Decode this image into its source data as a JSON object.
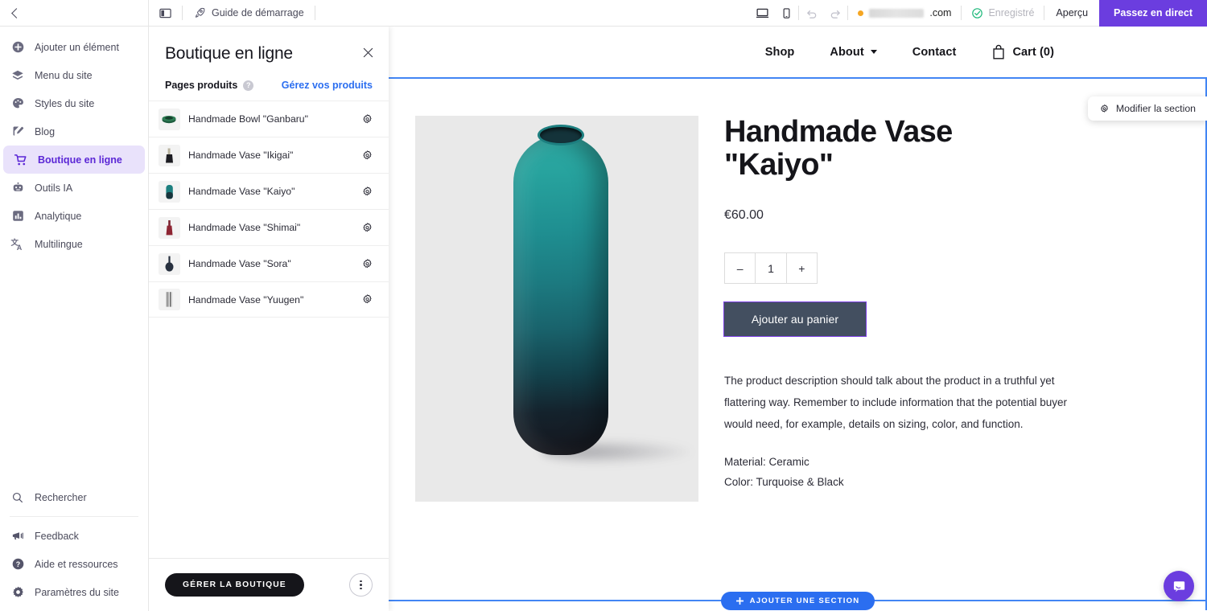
{
  "topbar": {
    "back_label": "back",
    "panel_toggle": "panel-toggle",
    "guide_label": "Guide de démarrage",
    "desktop_icon": "desktop-icon",
    "mobile_icon": "mobile-icon",
    "undo_icon": "undo-icon",
    "redo_icon": "redo-icon",
    "domain_suffix": ".com",
    "saved_label": "Enregistré",
    "preview_label": "Aperçu",
    "golive_label": "Passez en direct",
    "accent_purple": "#6b3ddf"
  },
  "sidebar": {
    "items": [
      {
        "label": "Ajouter un élément",
        "icon": "plus-circle-icon",
        "active": false
      },
      {
        "label": "Menu du site",
        "icon": "layers-icon",
        "active": false
      },
      {
        "label": "Styles du site",
        "icon": "palette-icon",
        "active": false
      },
      {
        "label": "Blog",
        "icon": "pencil-square-icon",
        "active": false
      },
      {
        "label": "Boutique en ligne",
        "icon": "shopping-cart-icon",
        "active": true
      },
      {
        "label": "Outils IA",
        "icon": "robot-icon",
        "active": false
      },
      {
        "label": "Analytique",
        "icon": "bar-chart-icon",
        "active": false
      },
      {
        "label": "Multilingue",
        "icon": "translate-icon",
        "active": false
      }
    ],
    "bottom_items": [
      {
        "label": "Rechercher",
        "icon": "search-icon"
      },
      {
        "label": "Feedback",
        "icon": "megaphone-icon"
      },
      {
        "label": "Aide et ressources",
        "icon": "question-circle-icon"
      },
      {
        "label": "Paramètres du site",
        "icon": "gear-icon"
      }
    ],
    "active_bg": "#e9e2fb",
    "active_fg": "#5b27d6"
  },
  "panel": {
    "title": "Boutique en ligne",
    "close_icon": "close-icon",
    "section_label": "Pages produits",
    "help_icon": "question-mark-icon",
    "manage_link": "Gérez vos produits",
    "products": [
      {
        "name": "Handmade Bowl \"Ganbaru\"",
        "thumb": "green-bowl",
        "gear": "gear-icon"
      },
      {
        "name": "Handmade Vase \"Ikigai\"",
        "thumb": "dark-bottle",
        "gear": "gear-icon"
      },
      {
        "name": "Handmade Vase \"Kaiyo\"",
        "thumb": "turquoise-vase",
        "gear": "gear-icon"
      },
      {
        "name": "Handmade Vase \"Shimai\"",
        "thumb": "red-bottle",
        "gear": "gear-icon"
      },
      {
        "name": "Handmade Vase \"Sora\"",
        "thumb": "navy-vase",
        "gear": "gear-icon"
      },
      {
        "name": "Handmade Vase \"Yuugen\"",
        "thumb": "grey-striped-vase",
        "gear": "gear-icon"
      }
    ],
    "manage_button": "GÉRER LA BOUTIQUE",
    "more_icon": "three-dots-icon"
  },
  "canvas": {
    "nav": [
      {
        "label": "Shop",
        "dropdown": false
      },
      {
        "label": "About",
        "dropdown": true
      },
      {
        "label": "Contact",
        "dropdown": false
      }
    ],
    "cart_label": "Cart (0)",
    "cart_icon": "shopping-bag-icon",
    "edit_section_label": "Modifier la section",
    "edit_section_icon": "gear-icon",
    "product": {
      "title": "Handmade Vase \"Kaiyo\"",
      "price": "€60.00",
      "qty_minus": "–",
      "qty_value": "1",
      "qty_plus": "+",
      "add_to_cart": "Ajouter au panier",
      "description": "The product description should talk about the product in a truthful yet flattering way. Remember to include information that the potential buyer would need, for example, details on sizing, color, and function.",
      "material": "Material: Ceramic",
      "color": "Color: Turquoise & Black",
      "image_alt": "turquoise-black-ceramic-vase"
    },
    "add_section_label": "AJOUTER UNE SECTION",
    "add_section_icon": "plus-icon",
    "selection_color": "#4285f4",
    "chat_icon": "chat-bubble-icon"
  }
}
